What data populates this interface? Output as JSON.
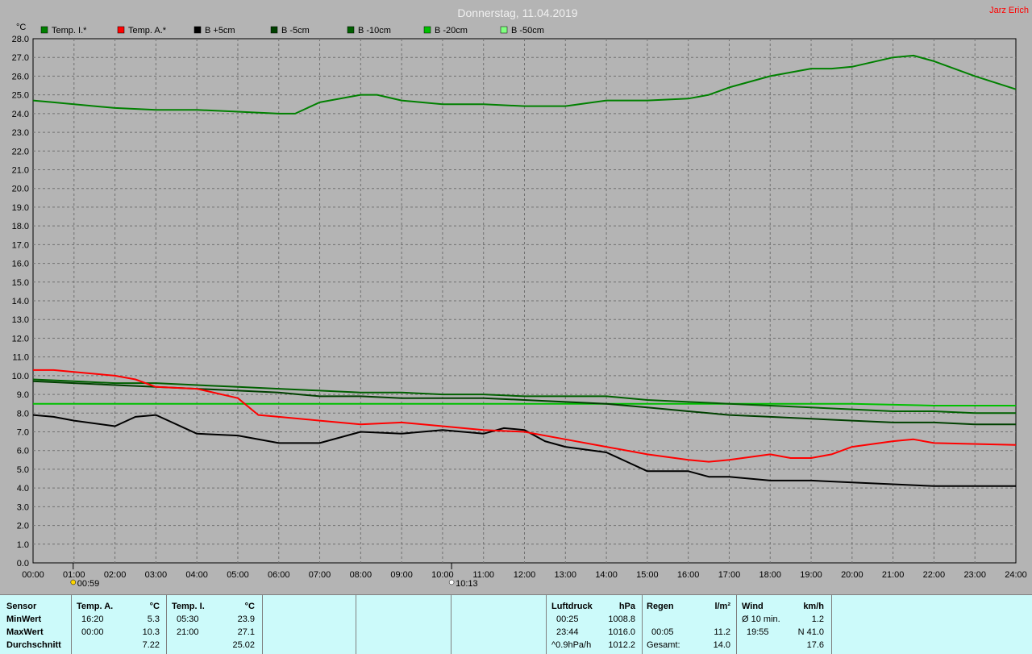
{
  "header": {
    "title": "Donnerstag, 11.04.2019",
    "author": "Jarz Erich"
  },
  "colors": {
    "background": "#b4b4b4",
    "footer_bg": "#ccfafa",
    "title": "#f0f0f0",
    "author": "#ff0000"
  },
  "chart_data": {
    "type": "line",
    "ylabel": "°C",
    "ylim": [
      0,
      28
    ],
    "yticks": [
      "0.0",
      "1.0",
      "2.0",
      "3.0",
      "4.0",
      "5.0",
      "6.0",
      "7.0",
      "8.0",
      "9.0",
      "10.0",
      "11.0",
      "12.0",
      "13.0",
      "14.0",
      "15.0",
      "16.0",
      "17.0",
      "18.0",
      "19.0",
      "20.0",
      "21.0",
      "22.0",
      "23.0",
      "24.0",
      "25.0",
      "26.0",
      "27.0",
      "28.0"
    ],
    "xlim": [
      0,
      24
    ],
    "xticks": [
      "00:00",
      "01:00",
      "02:00",
      "03:00",
      "04:00",
      "05:00",
      "06:00",
      "07:00",
      "08:00",
      "09:00",
      "10:00",
      "11:00",
      "12:00",
      "13:00",
      "14:00",
      "15:00",
      "16:00",
      "17:00",
      "18:00",
      "19:00",
      "20:00",
      "21:00",
      "22:00",
      "23:00",
      "24:00"
    ],
    "grid": true,
    "legend_position": "top",
    "legend": [
      {
        "name": "Temp. I.*",
        "color": "#008000"
      },
      {
        "name": "Temp. A.*",
        "color": "#ff0000"
      },
      {
        "name": "B +5cm",
        "color": "#000000"
      },
      {
        "name": "B -5cm",
        "color": "#004000"
      },
      {
        "name": "B -10cm",
        "color": "#006000"
      },
      {
        "name": "B -20cm",
        "color": "#00c000"
      },
      {
        "name": "B -50cm",
        "color": "#80ff80"
      }
    ],
    "markers": [
      {
        "label": "00:59",
        "x": 0.98,
        "kind": "sunrise"
      },
      {
        "label": "10:13",
        "x": 10.22,
        "kind": "sunset"
      }
    ],
    "series": [
      {
        "name": "Temp. I.*",
        "color": "#008000",
        "x": [
          0,
          0.5,
          1,
          2,
          3,
          4,
          5,
          6,
          6.4,
          7,
          8,
          8.4,
          9,
          10,
          11,
          12,
          13,
          14,
          15,
          16,
          16.5,
          17,
          18,
          19,
          19.5,
          20,
          21,
          21.5,
          22,
          23,
          24
        ],
        "y": [
          24.7,
          24.6,
          24.5,
          24.3,
          24.2,
          24.2,
          24.1,
          24.0,
          24.0,
          24.6,
          25.0,
          25.0,
          24.7,
          24.5,
          24.5,
          24.4,
          24.4,
          24.7,
          24.7,
          24.8,
          25.0,
          25.4,
          26.0,
          26.4,
          26.4,
          26.5,
          27.0,
          27.1,
          26.8,
          26.0,
          25.3
        ]
      },
      {
        "name": "Temp. A.*",
        "color": "#ff0000",
        "x": [
          0,
          0.5,
          1,
          2,
          2.5,
          3,
          4,
          5,
          5.5,
          6,
          7,
          8,
          9,
          10,
          11,
          12,
          13,
          14,
          15,
          16,
          16.5,
          17,
          18,
          18.5,
          19,
          19.5,
          20,
          21,
          21.5,
          22,
          24
        ],
        "y": [
          10.3,
          10.3,
          10.2,
          10.0,
          9.8,
          9.4,
          9.3,
          8.8,
          7.9,
          7.8,
          7.6,
          7.4,
          7.5,
          7.3,
          7.1,
          7.0,
          6.6,
          6.2,
          5.8,
          5.5,
          5.4,
          5.5,
          5.8,
          5.6,
          5.6,
          5.8,
          6.2,
          6.5,
          6.6,
          6.4,
          6.3
        ]
      },
      {
        "name": "B +5cm",
        "color": "#000000",
        "x": [
          0,
          0.5,
          1,
          2,
          2.5,
          3,
          4,
          5,
          6,
          7,
          8,
          9,
          10,
          11,
          11.5,
          12,
          12.5,
          13,
          14,
          14.5,
          15,
          16,
          16.5,
          17,
          18,
          19,
          20,
          21,
          22,
          23,
          24
        ],
        "y": [
          7.9,
          7.8,
          7.6,
          7.3,
          7.8,
          7.9,
          6.9,
          6.8,
          6.4,
          6.4,
          7.0,
          6.9,
          7.1,
          6.9,
          7.2,
          7.1,
          6.5,
          6.2,
          5.9,
          5.4,
          4.9,
          4.9,
          4.6,
          4.6,
          4.4,
          4.4,
          4.3,
          4.2,
          4.1,
          4.1,
          4.1
        ]
      },
      {
        "name": "B -5cm",
        "color": "#004000",
        "x": [
          0,
          1,
          2,
          3,
          4,
          5,
          6,
          7,
          8,
          9,
          10,
          11,
          12,
          13,
          14,
          15,
          16,
          17,
          18,
          19,
          20,
          21,
          22,
          23,
          24
        ],
        "y": [
          9.7,
          9.6,
          9.5,
          9.4,
          9.3,
          9.2,
          9.1,
          8.9,
          8.9,
          8.8,
          8.8,
          8.8,
          8.7,
          8.6,
          8.5,
          8.3,
          8.1,
          7.9,
          7.8,
          7.7,
          7.6,
          7.5,
          7.5,
          7.4,
          7.4
        ]
      },
      {
        "name": "B -10cm",
        "color": "#006000",
        "x": [
          0,
          1,
          2,
          3,
          4,
          5,
          6,
          7,
          8,
          9,
          10,
          11,
          12,
          13,
          14,
          15,
          16,
          17,
          18,
          19,
          20,
          21,
          22,
          23,
          24
        ],
        "y": [
          9.8,
          9.7,
          9.6,
          9.6,
          9.5,
          9.4,
          9.3,
          9.2,
          9.1,
          9.1,
          9.0,
          9.0,
          8.9,
          8.9,
          8.9,
          8.7,
          8.6,
          8.5,
          8.4,
          8.3,
          8.2,
          8.1,
          8.1,
          8.0,
          8.0
        ]
      },
      {
        "name": "B -20cm",
        "color": "#00c000",
        "x": [
          0,
          2,
          4,
          6,
          8,
          10,
          12,
          14,
          16,
          18,
          20,
          22,
          24
        ],
        "y": [
          8.5,
          8.5,
          8.5,
          8.5,
          8.5,
          8.5,
          8.5,
          8.5,
          8.5,
          8.5,
          8.5,
          8.4,
          8.4
        ]
      }
    ]
  },
  "footer": {
    "sensor": {
      "label": "Sensor",
      "min": "MinWert",
      "max": "MaxWert",
      "avg": "Durchschnitt"
    },
    "temp_a": {
      "label": "Temp. A.",
      "unit": "°C",
      "min_time": "16:20",
      "min_val": "5.3",
      "max_time": "00:00",
      "max_val": "10.3",
      "avg": "7.22"
    },
    "temp_i": {
      "label": "Temp. I.",
      "unit": "°C",
      "min_time": "05:30",
      "min_val": "23.9",
      "max_time": "21:00",
      "max_val": "27.1",
      "avg": "25.02"
    },
    "pressure": {
      "label": "Luftdruck",
      "unit": "hPa",
      "min_time": "00:25",
      "min_val": "1008.8",
      "max_time": "23:44",
      "max_val": "1016.0",
      "trend": "^0.9hPa/h",
      "trend_val": "1012.2"
    },
    "rain": {
      "label": "Regen",
      "unit": "l/m²",
      "max_time": "00:05",
      "max_val": "11.2",
      "total_label": "Gesamt:",
      "total_val": "14.0"
    },
    "wind": {
      "label": "Wind",
      "unit": "km/h",
      "avg_label": "Ø 10 min.",
      "avg_val": "1.2",
      "max_time": "19:55",
      "max_val": "N 41.0",
      "extra_val": "17.6"
    }
  }
}
